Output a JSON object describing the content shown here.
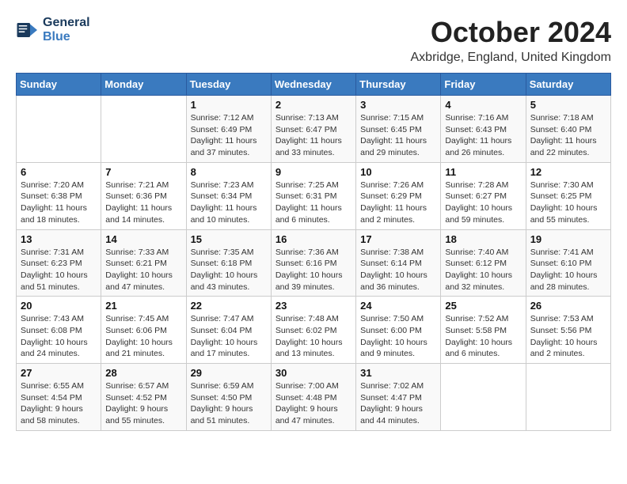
{
  "header": {
    "logo_line1": "General",
    "logo_line2": "Blue",
    "month": "October 2024",
    "location": "Axbridge, England, United Kingdom"
  },
  "weekdays": [
    "Sunday",
    "Monday",
    "Tuesday",
    "Wednesday",
    "Thursday",
    "Friday",
    "Saturday"
  ],
  "weeks": [
    [
      {
        "day": "",
        "info": ""
      },
      {
        "day": "",
        "info": ""
      },
      {
        "day": "1",
        "info": "Sunrise: 7:12 AM\nSunset: 6:49 PM\nDaylight: 11 hours\nand 37 minutes."
      },
      {
        "day": "2",
        "info": "Sunrise: 7:13 AM\nSunset: 6:47 PM\nDaylight: 11 hours\nand 33 minutes."
      },
      {
        "day": "3",
        "info": "Sunrise: 7:15 AM\nSunset: 6:45 PM\nDaylight: 11 hours\nand 29 minutes."
      },
      {
        "day": "4",
        "info": "Sunrise: 7:16 AM\nSunset: 6:43 PM\nDaylight: 11 hours\nand 26 minutes."
      },
      {
        "day": "5",
        "info": "Sunrise: 7:18 AM\nSunset: 6:40 PM\nDaylight: 11 hours\nand 22 minutes."
      }
    ],
    [
      {
        "day": "6",
        "info": "Sunrise: 7:20 AM\nSunset: 6:38 PM\nDaylight: 11 hours\nand 18 minutes."
      },
      {
        "day": "7",
        "info": "Sunrise: 7:21 AM\nSunset: 6:36 PM\nDaylight: 11 hours\nand 14 minutes."
      },
      {
        "day": "8",
        "info": "Sunrise: 7:23 AM\nSunset: 6:34 PM\nDaylight: 11 hours\nand 10 minutes."
      },
      {
        "day": "9",
        "info": "Sunrise: 7:25 AM\nSunset: 6:31 PM\nDaylight: 11 hours\nand 6 minutes."
      },
      {
        "day": "10",
        "info": "Sunrise: 7:26 AM\nSunset: 6:29 PM\nDaylight: 11 hours\nand 2 minutes."
      },
      {
        "day": "11",
        "info": "Sunrise: 7:28 AM\nSunset: 6:27 PM\nDaylight: 10 hours\nand 59 minutes."
      },
      {
        "day": "12",
        "info": "Sunrise: 7:30 AM\nSunset: 6:25 PM\nDaylight: 10 hours\nand 55 minutes."
      }
    ],
    [
      {
        "day": "13",
        "info": "Sunrise: 7:31 AM\nSunset: 6:23 PM\nDaylight: 10 hours\nand 51 minutes."
      },
      {
        "day": "14",
        "info": "Sunrise: 7:33 AM\nSunset: 6:21 PM\nDaylight: 10 hours\nand 47 minutes."
      },
      {
        "day": "15",
        "info": "Sunrise: 7:35 AM\nSunset: 6:18 PM\nDaylight: 10 hours\nand 43 minutes."
      },
      {
        "day": "16",
        "info": "Sunrise: 7:36 AM\nSunset: 6:16 PM\nDaylight: 10 hours\nand 39 minutes."
      },
      {
        "day": "17",
        "info": "Sunrise: 7:38 AM\nSunset: 6:14 PM\nDaylight: 10 hours\nand 36 minutes."
      },
      {
        "day": "18",
        "info": "Sunrise: 7:40 AM\nSunset: 6:12 PM\nDaylight: 10 hours\nand 32 minutes."
      },
      {
        "day": "19",
        "info": "Sunrise: 7:41 AM\nSunset: 6:10 PM\nDaylight: 10 hours\nand 28 minutes."
      }
    ],
    [
      {
        "day": "20",
        "info": "Sunrise: 7:43 AM\nSunset: 6:08 PM\nDaylight: 10 hours\nand 24 minutes."
      },
      {
        "day": "21",
        "info": "Sunrise: 7:45 AM\nSunset: 6:06 PM\nDaylight: 10 hours\nand 21 minutes."
      },
      {
        "day": "22",
        "info": "Sunrise: 7:47 AM\nSunset: 6:04 PM\nDaylight: 10 hours\nand 17 minutes."
      },
      {
        "day": "23",
        "info": "Sunrise: 7:48 AM\nSunset: 6:02 PM\nDaylight: 10 hours\nand 13 minutes."
      },
      {
        "day": "24",
        "info": "Sunrise: 7:50 AM\nSunset: 6:00 PM\nDaylight: 10 hours\nand 9 minutes."
      },
      {
        "day": "25",
        "info": "Sunrise: 7:52 AM\nSunset: 5:58 PM\nDaylight: 10 hours\nand 6 minutes."
      },
      {
        "day": "26",
        "info": "Sunrise: 7:53 AM\nSunset: 5:56 PM\nDaylight: 10 hours\nand 2 minutes."
      }
    ],
    [
      {
        "day": "27",
        "info": "Sunrise: 6:55 AM\nSunset: 4:54 PM\nDaylight: 9 hours\nand 58 minutes."
      },
      {
        "day": "28",
        "info": "Sunrise: 6:57 AM\nSunset: 4:52 PM\nDaylight: 9 hours\nand 55 minutes."
      },
      {
        "day": "29",
        "info": "Sunrise: 6:59 AM\nSunset: 4:50 PM\nDaylight: 9 hours\nand 51 minutes."
      },
      {
        "day": "30",
        "info": "Sunrise: 7:00 AM\nSunset: 4:48 PM\nDaylight: 9 hours\nand 47 minutes."
      },
      {
        "day": "31",
        "info": "Sunrise: 7:02 AM\nSunset: 4:47 PM\nDaylight: 9 hours\nand 44 minutes."
      },
      {
        "day": "",
        "info": ""
      },
      {
        "day": "",
        "info": ""
      }
    ]
  ]
}
